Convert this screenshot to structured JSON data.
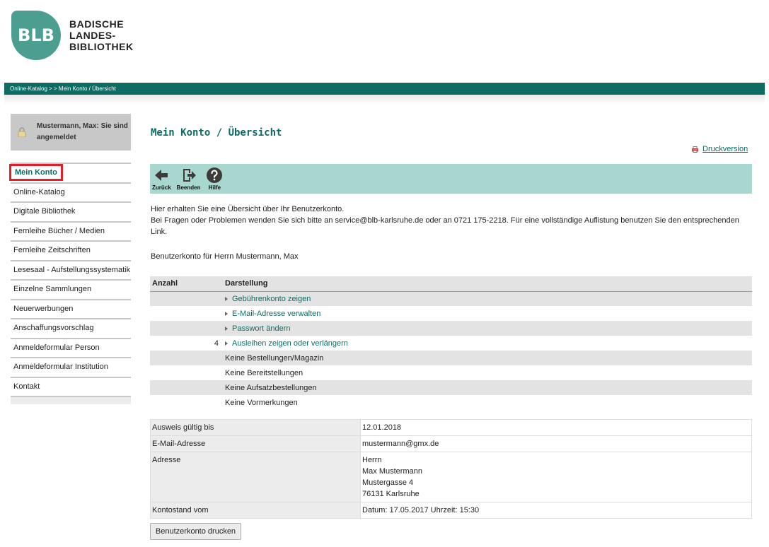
{
  "logo": {
    "mark": "BLB",
    "line1": "BADISCHE",
    "line2": "LANDES-",
    "line3": "BIBLIOTHEK"
  },
  "breadcrumb": "Online-Katalog > > Mein Konto / Übersicht",
  "user": {
    "status": "Mustermann, Max: Sie sind angemeldet"
  },
  "sidebar": {
    "items": [
      {
        "label": "Mein Konto"
      },
      {
        "label": "Online-Katalog"
      },
      {
        "label": "Digitale Bibliothek"
      },
      {
        "label": "Fernleihe Bücher / Medien"
      },
      {
        "label": "Fernleihe Zeitschriften"
      },
      {
        "label": "Lesesaal - Aufstellungssystematik"
      },
      {
        "label": "Einzelne Sammlungen"
      },
      {
        "label": "Neuerwerbungen"
      },
      {
        "label": "Anschaffungsvorschlag"
      },
      {
        "label": "Anmeldeformular Person"
      },
      {
        "label": "Anmeldeformular Institution"
      },
      {
        "label": "Kontakt"
      }
    ]
  },
  "main": {
    "title": "Mein Konto / Übersicht",
    "print_link": "Druckversion",
    "toolbar": {
      "back": "Zurück",
      "quit": "Beenden",
      "help": "Hilfe"
    },
    "intro_line1": "Hier erhalten Sie eine Übersicht über Ihr Benutzerkonto.",
    "intro_line2": "Bei Fragen oder Problemen wenden Sie sich bitte an service@blb-karlsruhe.de oder an 0721 175-2218. Für eine vollständige Auflistung benutzen Sie den entsprechenden Link.",
    "account_for": "Benutzerkonto für Herrn Mustermann, Max",
    "overview": {
      "headers": {
        "count": "Anzahl",
        "display": "Darstellung"
      },
      "rows": [
        {
          "count": "",
          "label": "Gebührenkonto zeigen"
        },
        {
          "count": "",
          "label": "E-Mail-Adresse verwalten"
        },
        {
          "count": "",
          "label": "Passwort ändern"
        },
        {
          "count": "4",
          "label": "Ausleihen zeigen oder verlängern"
        },
        {
          "count": "",
          "label": "Keine Bestellungen/Magazin"
        },
        {
          "count": "",
          "label": "Keine Bereitstellungen"
        },
        {
          "count": "",
          "label": "Keine Aufsatzbestellungen"
        },
        {
          "count": "",
          "label": "Keine Vormerkungen"
        }
      ]
    },
    "details": {
      "valid_label": "Ausweis gültig bis",
      "valid_value": "12.01.2018",
      "email_label": "E-Mail-Adresse",
      "email_value": "mustermann@gmx.de",
      "address_label": "Adresse",
      "address_1": "Herrn",
      "address_2": "Max Mustermann",
      "address_3": "Mustergasse 4",
      "address_4": "76131 Karlsruhe",
      "balance_label": "Kontostand vom",
      "balance_value": "Datum: 17.05.2017 Uhrzeit: 15:30"
    },
    "print_button": "Benutzerkonto drucken"
  }
}
